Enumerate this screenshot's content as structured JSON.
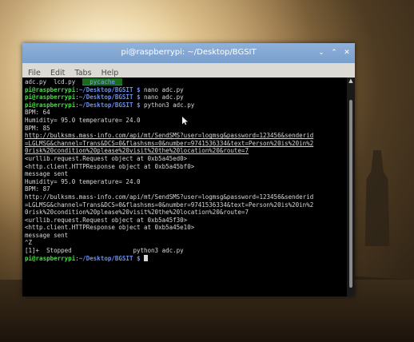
{
  "window": {
    "title": "pi@raspberrypi: ~/Desktop/BGSIT",
    "minimize_glyph": "⌄",
    "maximize_glyph": "⌃",
    "close_glyph": "✕"
  },
  "menubar": {
    "items": [
      "File",
      "Edit",
      "Tabs",
      "Help"
    ]
  },
  "terminal": {
    "files_line": {
      "files": "adc.py  lcd.py  ",
      "dir": "__pycache__"
    },
    "prompt_user": "pi@raspberrypi",
    "prompt_path": "~/Desktop/BGSIT $",
    "commands": [
      "nano adc.py",
      "nano adc.py",
      "python3 adc.py"
    ],
    "output": [
      "BPM: 64",
      "Humidity= 95.0 temperature= 24.0",
      "BPM: 85",
      "http://bulksms.mass-info.com/api/mt/SendSMS?user=logmsg&password=123456&senderid",
      "=LGLMSG&channel=Trans&DCS=0&flashsms=0&number=9741536334&text=Person%20is%20in%2",
      "0risk%20condition%20please%20visit%20the%20location%20&route=7",
      "<urllib.request.Request object at 0xb5a45ed0>",
      "<http.client.HTTPResponse object at 0xb5a45bf0>",
      "message sent",
      "Humidity= 95.0 temperature= 24.0",
      "BPM: 87",
      "http://bulksms.mass-info.com/api/mt/SendSMS?user=logmsg&password=123456&senderid",
      "=LGLMSG&channel=Trans&DCS=0&flashsms=0&number=9741536334&text=Person%20is%20in%2",
      "0risk%20condition%20please%20visit%20the%20location%20&route=7",
      "<urllib.request.Request object at 0xb5a45f30>",
      "<http.client.HTTPResponse object at 0xb5a45e10>",
      "message sent",
      "^Z",
      "[1]+  Stopped                 python3 adc.py"
    ]
  },
  "colors": {
    "titlebar": "#7a9fcc",
    "prompt_user": "#4ed84e",
    "prompt_path": "#6f8fe8",
    "terminal_bg": "#000000",
    "terminal_fg": "#d8d8d8"
  }
}
